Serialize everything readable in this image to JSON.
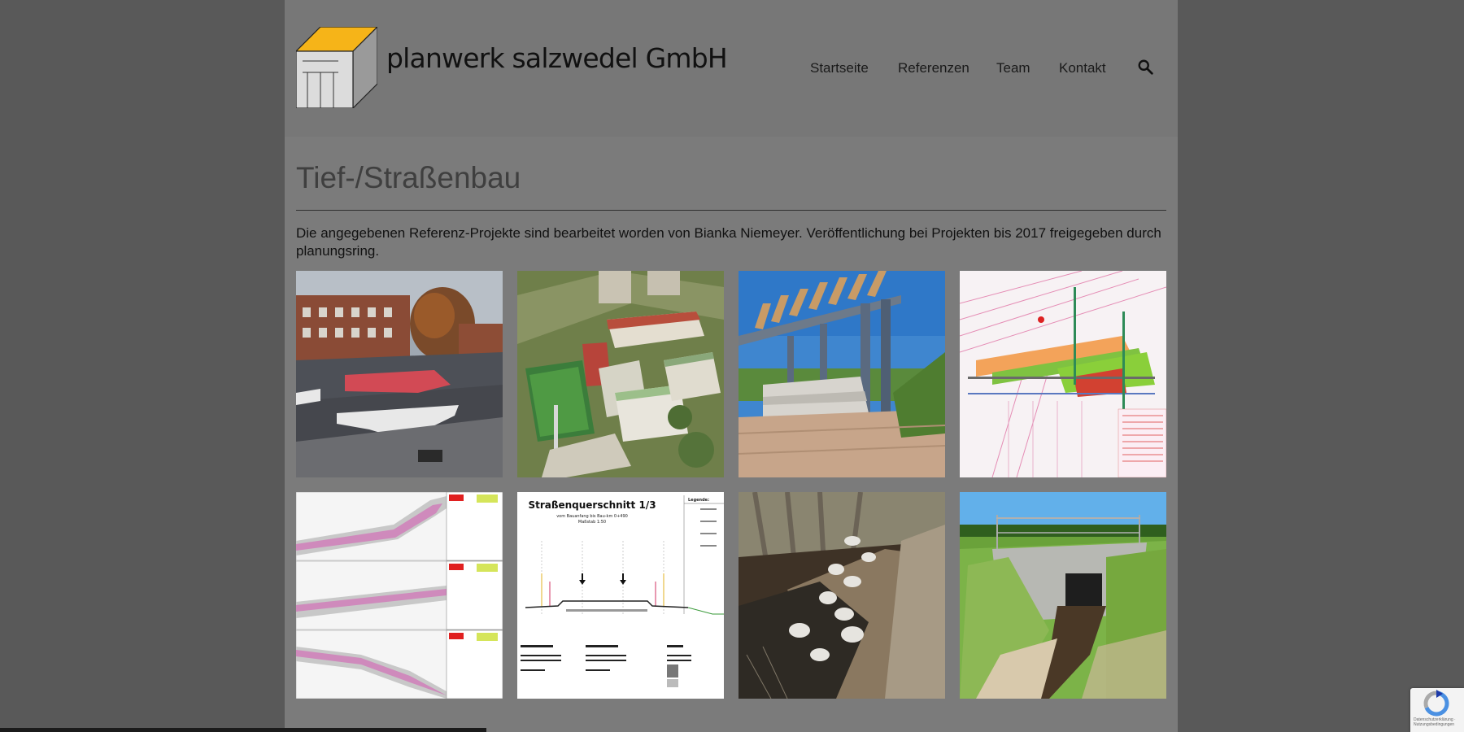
{
  "header": {
    "brand": "planwerk salzwedel GmbH",
    "nav": [
      {
        "label": "Startseite"
      },
      {
        "label": "Referenzen"
      },
      {
        "label": "Team"
      },
      {
        "label": "Kontakt"
      }
    ],
    "search_icon": "search-icon"
  },
  "main": {
    "title": "Tief-/Straßenbau",
    "intro": "Die angegebenen Referenz-Projekte sind bearbeitet worden von Bianka Niemeyer. Veröffentlichung bei Projekten bis 2017 freigegeben durch planungsring."
  },
  "gallery": {
    "drawing_cross_section": {
      "title": "Straßenquerschnitt 1/3",
      "subtitle": "vom Bauanfang bis Bau-km 0+490",
      "scale": "Maßstab 1:50",
      "legend": "Legende:"
    }
  },
  "recaptcha": {
    "text": "Datenschutzerklärung · Nutzungsbedingungen"
  },
  "colors": {
    "page_bg": "#7b7b7b",
    "outer_bg": "#595959",
    "logo_yellow": "#f6b418"
  }
}
